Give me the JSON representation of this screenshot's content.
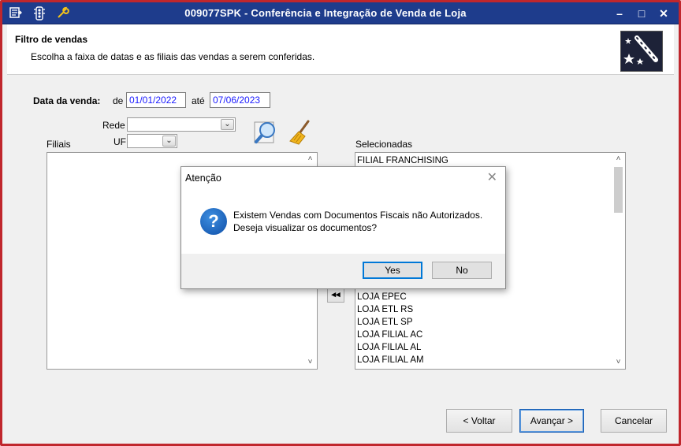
{
  "window": {
    "title": "009077SPK - Conferência e Integração de Venda de Loja",
    "controls": {
      "minimize": "–",
      "maximize": "□",
      "close": "✕"
    }
  },
  "header": {
    "title": "Filtro de vendas",
    "subtitle": "Escolha a faixa de datas e as filiais das vendas a serem conferidas."
  },
  "form": {
    "date_label": "Data da venda:",
    "from_label": "de",
    "from_value": "01/01/2022",
    "to_label": "até",
    "to_value": "07/06/2023",
    "rede_label": "Rede",
    "uf_label": "UF",
    "filiais_label": "Filiais",
    "selecionadas_label": "Selecionadas"
  },
  "selected_items": [
    "FILIAL FRANCHISING",
    "LOJA EPEC",
    "LOJA ETL RS",
    "LOJA ETL SP",
    "LOJA FILIAL AC",
    "LOJA FILIAL AL",
    "LOJA FILIAL AM"
  ],
  "buttons": {
    "move_all_left": "◂◂",
    "back": "< Voltar",
    "next": "Avançar >",
    "cancel": "Cancelar"
  },
  "dialog": {
    "title": "Atenção",
    "line1": "Existem Vendas com Documentos Fiscais não Autorizados.",
    "line2": "Deseja visualizar os documentos?",
    "yes": "Yes",
    "no": "No",
    "icon": "question-icon"
  },
  "colors": {
    "titlebar": "#1e3c8c",
    "frame_border": "#c0272d",
    "input_text": "#1a1aff"
  }
}
